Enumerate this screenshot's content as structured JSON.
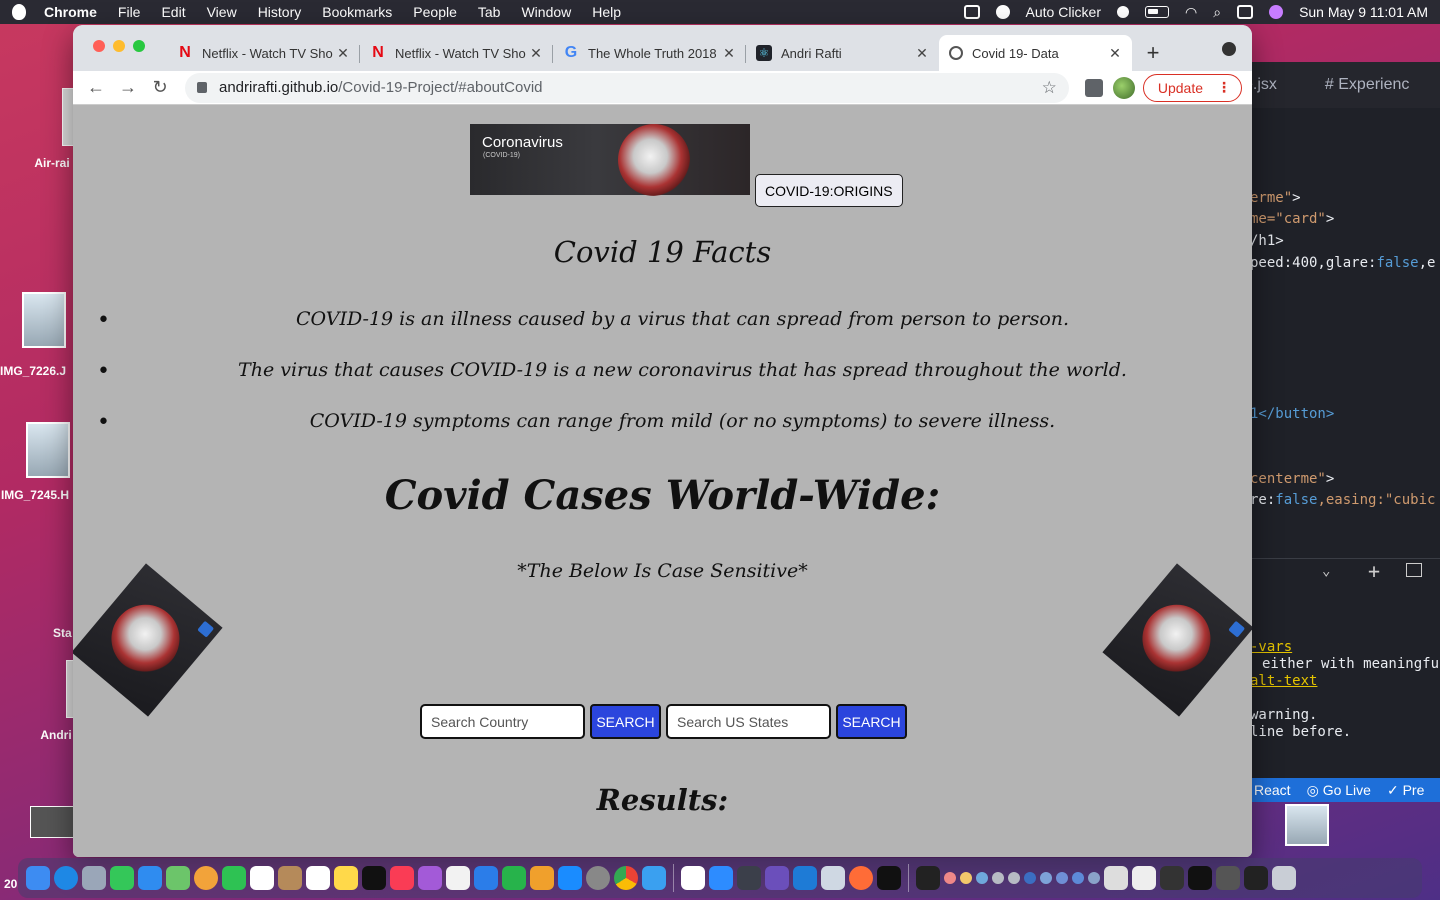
{
  "menubar": {
    "app": "Chrome",
    "items": [
      "File",
      "Edit",
      "View",
      "History",
      "Bookmarks",
      "People",
      "Tab",
      "Window",
      "Help"
    ],
    "auto_clicker": "Auto Clicker",
    "clock": "Sun May 9  11:01 AM"
  },
  "desktop": {
    "labels": [
      "Air-rai",
      "IMG_7226.J",
      "IMG_7245.H",
      "Sta",
      "Andri",
      "20"
    ]
  },
  "editor": {
    "tabs": [
      "e.jsx",
      "# Experienc"
    ],
    "lines": [
      {
        "pre": "",
        "str": "erme\"",
        "post": ">"
      },
      {
        "pre": "",
        "str": "me=\"card\"",
        "post": ">"
      },
      {
        "pre": "/h1>",
        "str": "",
        "post": ""
      },
      {
        "pre": "peed:400,glare:",
        "str": "false",
        "post": ",e"
      },
      {
        "pre": "1</button>",
        "str": "",
        "post": ""
      },
      {
        "pre": "",
        "str": "centerme\"",
        "post": ">"
      },
      {
        "pre": "re:",
        "str": "false",
        "post": ",easing:\"cubic"
      }
    ],
    "terminal": [
      "-vars",
      "either with meaningfu",
      "alt-text",
      "warning.",
      "line before."
    ],
    "status": [
      "React",
      "Go Live",
      "Pre"
    ]
  },
  "browser": {
    "tabs": [
      {
        "title": "Netflix - Watch TV Sho",
        "icon": "netflix-icon"
      },
      {
        "title": "Netflix - Watch TV Sho",
        "icon": "netflix-icon"
      },
      {
        "title": "The Whole Truth 2018",
        "icon": "google-icon"
      },
      {
        "title": "Andri Rafti",
        "icon": "react-icon"
      },
      {
        "title": "Covid 19- Data",
        "icon": "globe-icon",
        "active": true
      }
    ],
    "url_host": "andrirafti.github.io",
    "url_path": "/Covid-19-Project/#aboutCovid",
    "update_label": "Update"
  },
  "page": {
    "banner_title": "Coronavirus",
    "banner_subtitle": "(COVID-19)",
    "origins_button": "COVID-19:ORIGINS",
    "facts_title": "Covid 19 Facts",
    "facts": [
      "COVID-19 is an illness caused by a virus that can spread from person to person.",
      "The virus that causes COVID-19 is a new coronavirus that has spread throughout the world.",
      "COVID-19 symptoms can range from mild (or no symptoms) to severe illness."
    ],
    "cases_title": "Covid Cases World-Wide:",
    "case_note": "*The Below Is Case Sensitive*",
    "search_country_placeholder": "Search Country",
    "search_states_placeholder": "Search US States",
    "search_button": "SEARCH",
    "results_title": "Results:"
  },
  "colors": {
    "search_button": "#2b45dd",
    "page_background": "#b4b4b4",
    "update_accent": "#d93025"
  }
}
